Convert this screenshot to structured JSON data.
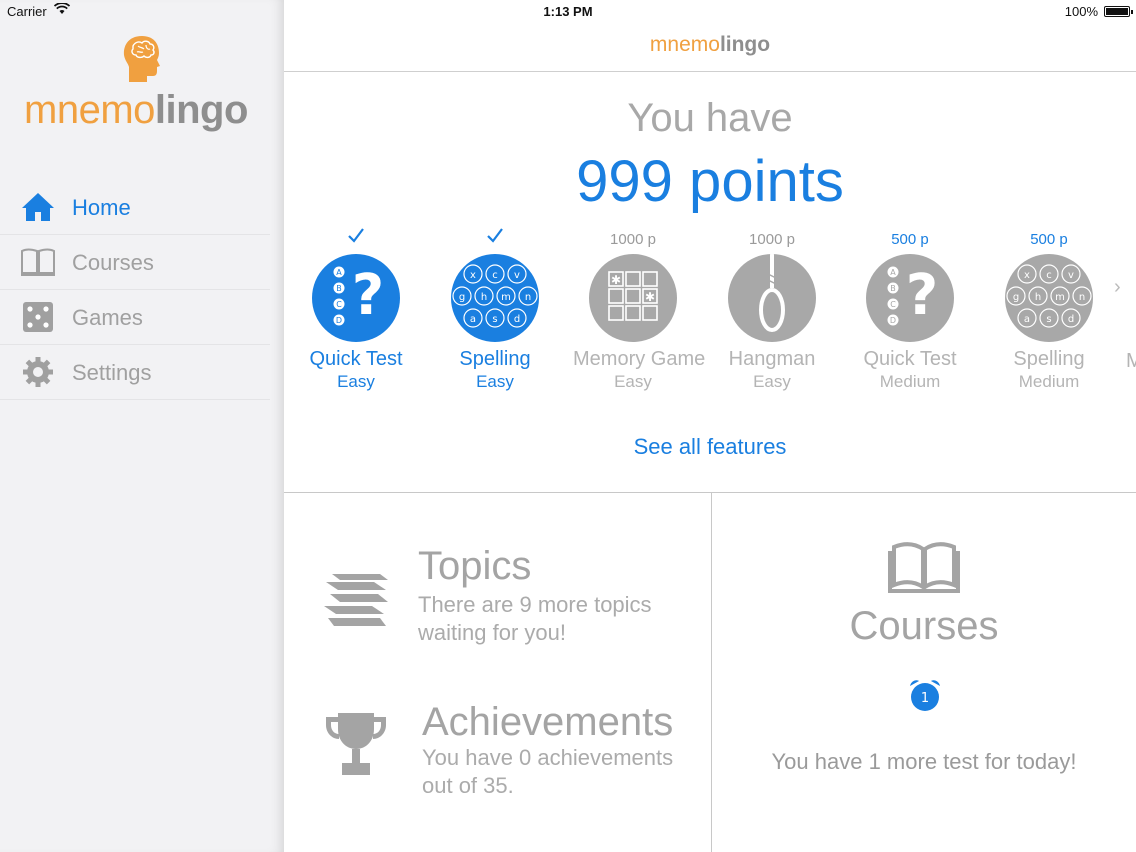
{
  "status_bar": {
    "carrier": "Carrier",
    "time": "1:13 PM",
    "battery": "100%"
  },
  "brand": {
    "part1": "mnemo",
    "part2": "lingo"
  },
  "sidebar": {
    "items": [
      {
        "label": "Home",
        "icon": "home-icon",
        "active": true
      },
      {
        "label": "Courses",
        "icon": "book-icon",
        "active": false
      },
      {
        "label": "Games",
        "icon": "dice-icon",
        "active": false
      },
      {
        "label": "Settings",
        "icon": "gear-icon",
        "active": false
      }
    ]
  },
  "main": {
    "you_have": "You have",
    "points": "999 points",
    "features": [
      {
        "name": "Quick Test",
        "level": "Easy",
        "cost": "",
        "done": true,
        "icon": "quiz-icon"
      },
      {
        "name": "Spelling",
        "level": "Easy",
        "cost": "",
        "done": true,
        "icon": "spelling-icon"
      },
      {
        "name": "Memory Game",
        "level": "Easy",
        "cost": "1000 p",
        "done": false,
        "icon": "memory-grid-icon"
      },
      {
        "name": "Hangman",
        "level": "Easy",
        "cost": "1000 p",
        "done": false,
        "icon": "noose-icon"
      },
      {
        "name": "Quick Test",
        "level": "Medium",
        "cost": "500 p",
        "done": false,
        "icon": "quiz-icon"
      },
      {
        "name": "Spelling",
        "level": "Medium",
        "cost": "500 p",
        "done": false,
        "icon": "spelling-icon"
      }
    ],
    "feature_cut": "M",
    "see_all": "See all features",
    "topics": {
      "title": "Topics",
      "text_line1": "There are 9 more topics",
      "text_line2": "waiting for you!"
    },
    "achievements": {
      "title": "Achievements",
      "text_line1": "You have 0 achievements",
      "text_line2": "out of 35."
    },
    "courses": {
      "title": "Courses",
      "badge": "1",
      "message": "You have 1 more test for today!"
    }
  },
  "colors": {
    "accent": "#1a7fe0",
    "brand_orange": "#f0a040",
    "gray": "#a8a8a8"
  }
}
